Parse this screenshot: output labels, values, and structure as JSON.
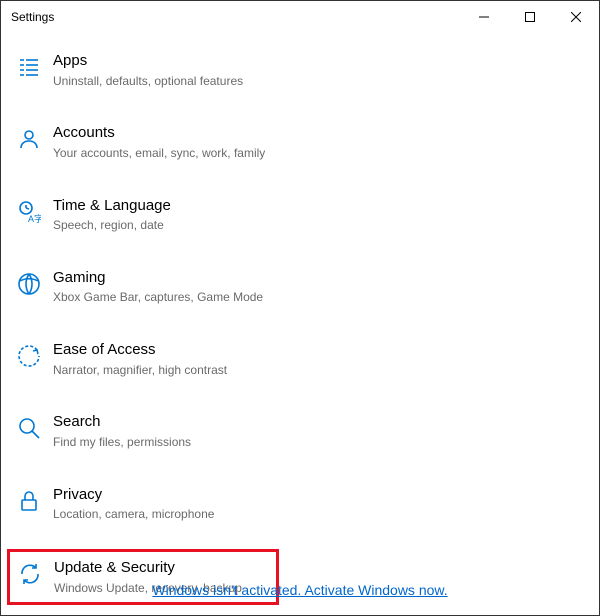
{
  "window": {
    "title": "Settings"
  },
  "items": [
    {
      "title": "Apps",
      "desc": "Uninstall, defaults, optional features"
    },
    {
      "title": "Accounts",
      "desc": "Your accounts, email, sync, work, family"
    },
    {
      "title": "Time & Language",
      "desc": "Speech, region, date"
    },
    {
      "title": "Gaming",
      "desc": "Xbox Game Bar, captures, Game Mode"
    },
    {
      "title": "Ease of Access",
      "desc": "Narrator, magnifier, high contrast"
    },
    {
      "title": "Search",
      "desc": "Find my files, permissions"
    },
    {
      "title": "Privacy",
      "desc": "Location, camera, microphone"
    },
    {
      "title": "Update & Security",
      "desc": "Windows Update, recovery, backup"
    }
  ],
  "activation": {
    "text": "Windows isn't activated. Activate Windows now."
  }
}
